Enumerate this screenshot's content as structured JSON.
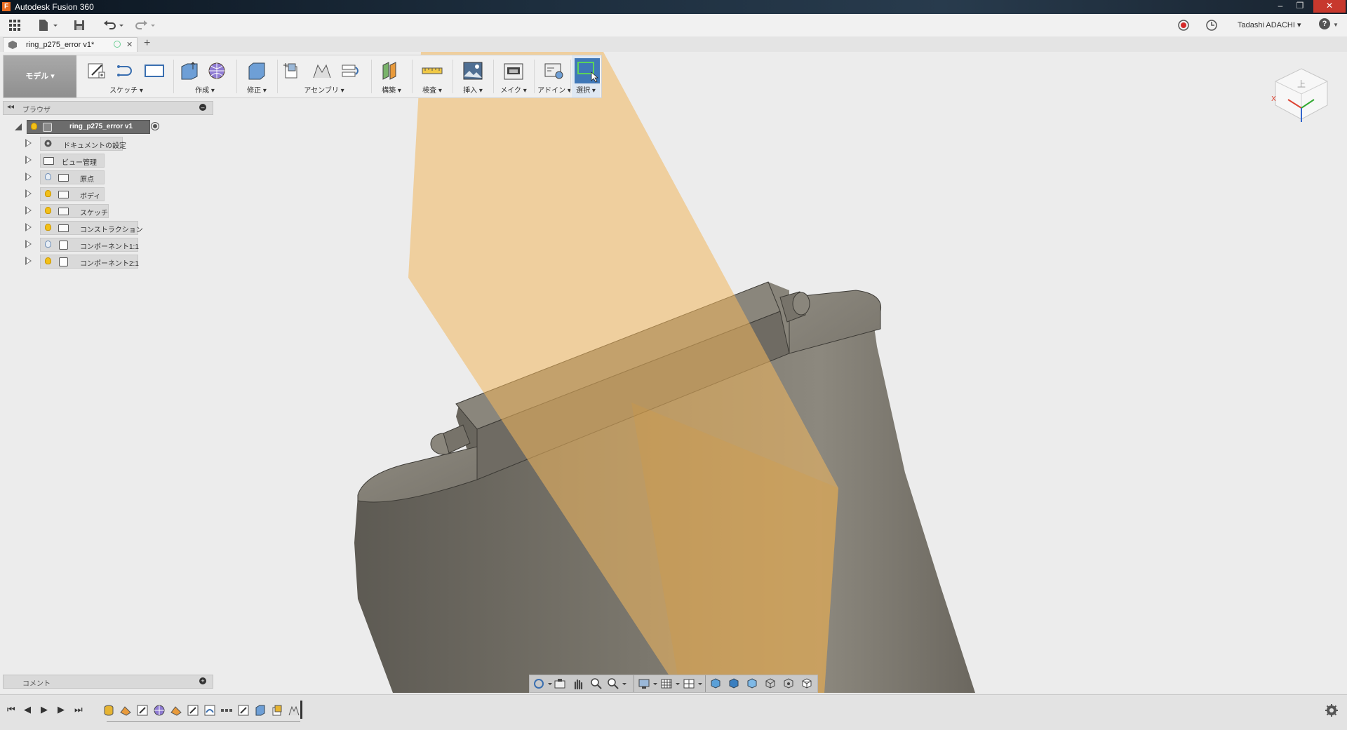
{
  "app": {
    "window_title": "Autodesk Fusion 360",
    "logo_letter": "F"
  },
  "window_controls": {
    "minimize": "–",
    "maximize": "❐",
    "close": "✕"
  },
  "qat": {
    "user_name": "Tadashi ADACHI ▾",
    "help": "?"
  },
  "tab": {
    "doc_name": "ring_p275_error v1*",
    "close": "✕",
    "new_tab": "+"
  },
  "toolbar": {
    "workspace": "モデル ▾",
    "groups": {
      "sketch": "スケッチ ▾",
      "create": "作成 ▾",
      "modify": "修正 ▾",
      "assemble": "アセンブリ ▾",
      "construct": "構築 ▾",
      "inspect": "検査 ▾",
      "insert": "挿入 ▾",
      "make": "メイク ▾",
      "addins": "アドイン ▾",
      "select": "選択 ▾"
    }
  },
  "browser": {
    "title": "ブラウザ",
    "root": "ring_p275_error v1",
    "items": [
      {
        "label": "ドキュメントの設定"
      },
      {
        "label": "ビュー管理"
      },
      {
        "label": "原点"
      },
      {
        "label": "ボディ"
      },
      {
        "label": "スケッチ"
      },
      {
        "label": "コンストラクション"
      },
      {
        "label": "コンポーネント1:1"
      },
      {
        "label": "コンポーネント2:1"
      }
    ]
  },
  "comment": {
    "title": "コメント"
  },
  "colors": {
    "construction_plane": "#f3c47a",
    "model_body": "#6e6a62",
    "select_active": "#3f78b8"
  }
}
